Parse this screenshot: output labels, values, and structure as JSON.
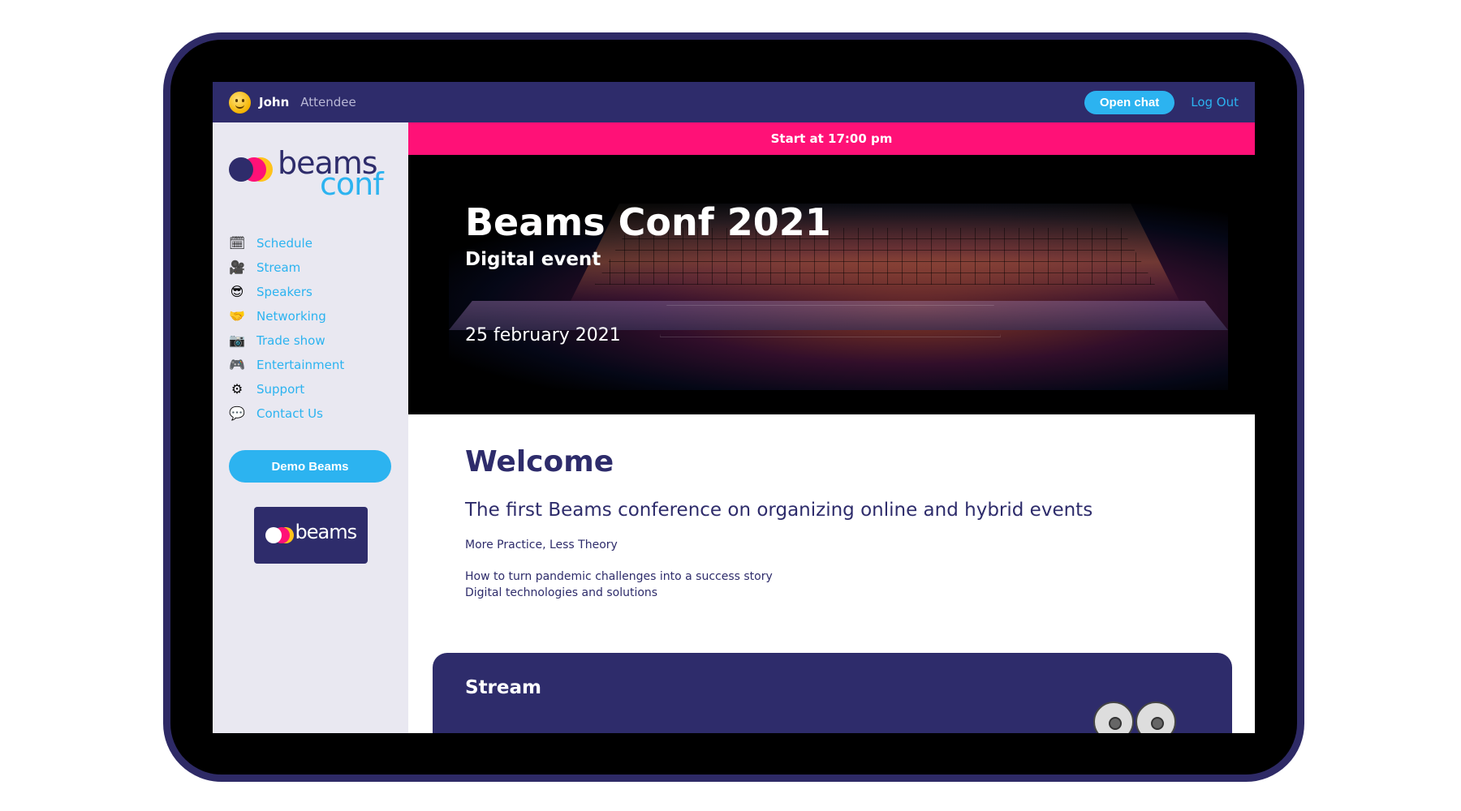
{
  "header": {
    "user_name": "John",
    "user_role": "Attendee",
    "open_chat_label": "Open chat",
    "logout_label": "Log Out"
  },
  "sidebar": {
    "logo_word1": "beams",
    "logo_word2": "conf",
    "items": [
      {
        "label": "Schedule",
        "icon": "calendar-icon"
      },
      {
        "label": "Stream",
        "icon": "video-camera-icon"
      },
      {
        "label": "Speakers",
        "icon": "sunglasses-face-icon"
      },
      {
        "label": "Networking",
        "icon": "handshake-icon"
      },
      {
        "label": "Trade show",
        "icon": "camera-icon"
      },
      {
        "label": "Entertainment",
        "icon": "gamepad-icon"
      },
      {
        "label": "Support",
        "icon": "gear-icon"
      },
      {
        "label": "Contact Us",
        "icon": "speech-bubble-icon"
      }
    ],
    "demo_button_label": "Demo Beams",
    "sponsor_logo_text": "beams"
  },
  "main": {
    "banner_text": "Start at 17:00 pm",
    "hero": {
      "title": "Beams Conf 2021",
      "subtitle": "Digital event",
      "date": "25 february 2021"
    },
    "welcome": {
      "heading": "Welcome",
      "lead": "The first Beams conference on organizing online and hybrid events",
      "line1": "More Practice, Less Theory",
      "line2": "How to turn pandemic challenges into a success story",
      "line3": "Digital technologies and solutions"
    },
    "stream_card": {
      "title": "Stream"
    }
  },
  "colors": {
    "brand_navy": "#2e2c6b",
    "accent_blue": "#2cb3f0",
    "accent_pink": "#ff1177",
    "accent_yellow": "#ffc21a"
  }
}
